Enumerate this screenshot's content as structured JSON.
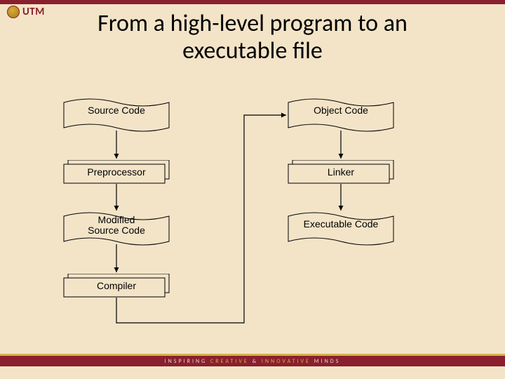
{
  "logo": {
    "text": "UTM"
  },
  "title_line1": "From a high-level program to an",
  "title_line2": "executable file",
  "nodes": {
    "source_code": "Source Code",
    "preprocessor": "Preprocessor",
    "modified_source_line1": "Modified",
    "modified_source_line2": "Source Code",
    "compiler": "Compiler",
    "object_code": "Object Code",
    "linker": "Linker",
    "executable_code": "Executable Code"
  },
  "footer": {
    "inspiring": "INSPIRING",
    "creative": "CREATIVE",
    "and": "&",
    "innovative": "INNOVATIVE",
    "minds": "MINDS"
  },
  "colors": {
    "background": "#f3e4c8",
    "maroon": "#8a1f2d",
    "gold": "#d4b24a"
  }
}
